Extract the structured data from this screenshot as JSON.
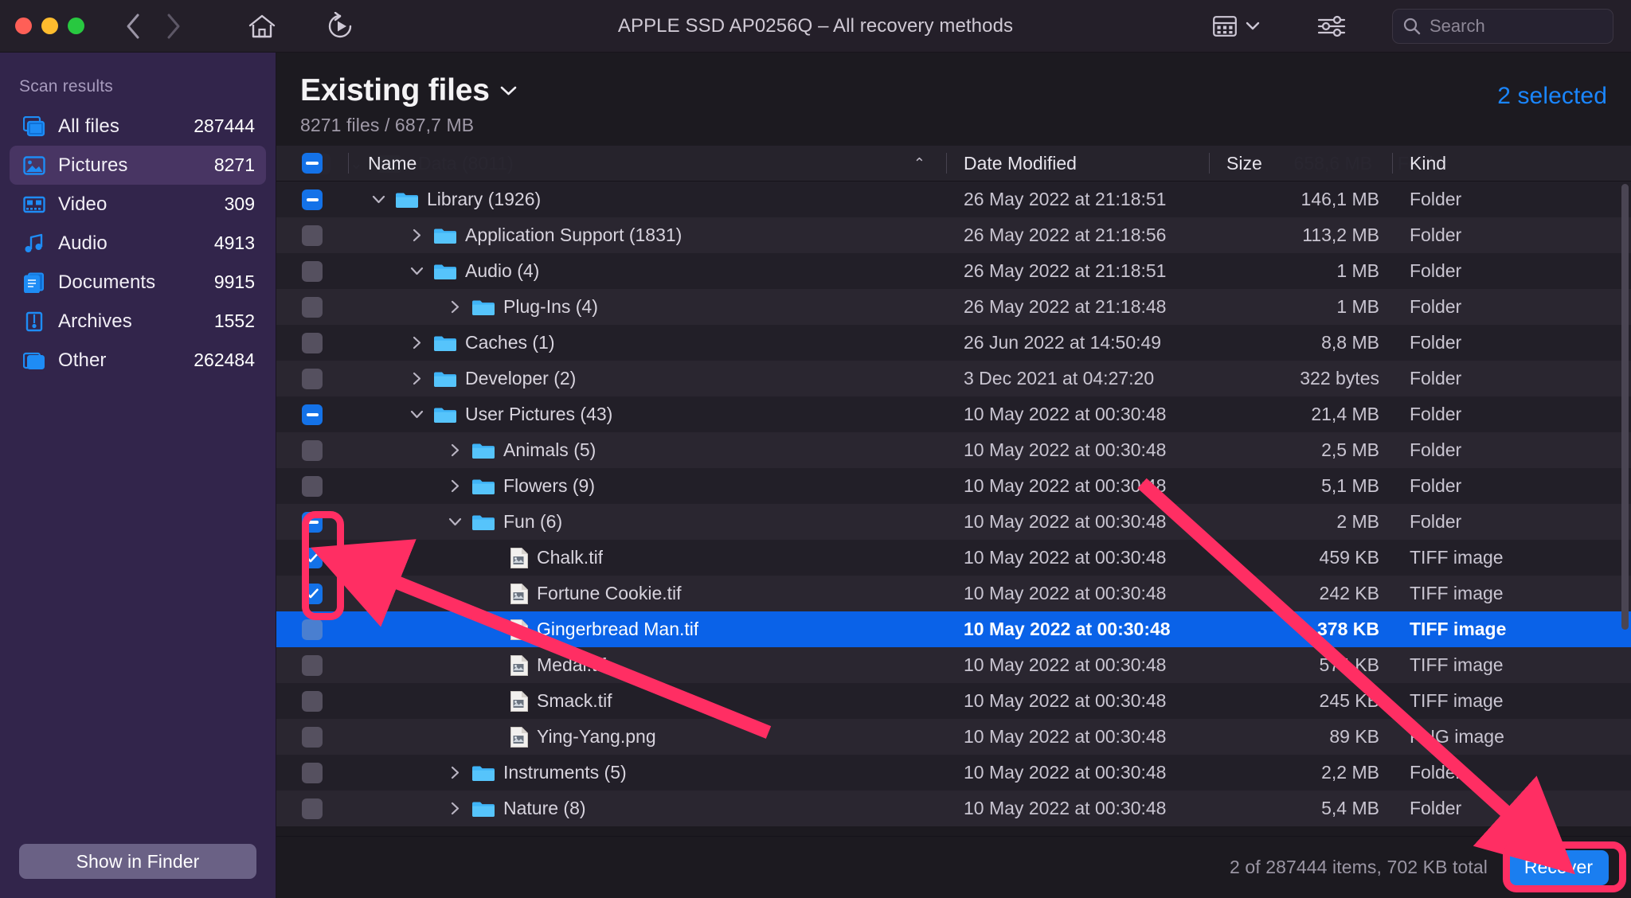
{
  "window": {
    "title": "APPLE SSD AP0256Q – All recovery methods",
    "traffic": [
      "close-button",
      "minimize-button",
      "maximize-button"
    ],
    "back_icon": "chevron-left-icon",
    "forward_icon": "chevron-right-icon",
    "home_icon": "home-icon",
    "rescan_icon": "replay-icon",
    "view_icon": "grid-view-icon",
    "view_chevron": "chevron-down-icon",
    "filter_icon": "sliders-icon",
    "search": {
      "placeholder": "Search",
      "value": "",
      "icon": "search-icon"
    }
  },
  "sidebar": {
    "header": "Scan results",
    "items": [
      {
        "label": "All files",
        "count": "287444",
        "icon": "all-files-icon",
        "active": false
      },
      {
        "label": "Pictures",
        "count": "8271",
        "icon": "pictures-icon",
        "active": true
      },
      {
        "label": "Video",
        "count": "309",
        "icon": "video-icon",
        "active": false
      },
      {
        "label": "Audio",
        "count": "4913",
        "icon": "audio-icon",
        "active": false
      },
      {
        "label": "Documents",
        "count": "9915",
        "icon": "documents-icon",
        "active": false
      },
      {
        "label": "Archives",
        "count": "1552",
        "icon": "archives-icon",
        "active": false
      },
      {
        "label": "Other",
        "count": "262484",
        "icon": "other-icon",
        "active": false
      }
    ],
    "show_in_finder": "Show in Finder"
  },
  "main": {
    "title": "Existing files",
    "title_chevron": "chevron-down-icon",
    "subtitle": "8271 files / 687,7 MB",
    "selected_label": "2 selected",
    "ghost_row": {
      "name": "Data (8011)",
      "size": "658,6 MB",
      "kind": "Folder"
    },
    "columns": {
      "name": "Name",
      "date": "Date Modified",
      "size": "Size",
      "kind": "Kind",
      "sort_icon": "chevron-up-icon",
      "header_checkbox": "mixed"
    },
    "rows": [
      {
        "name": "Library (1926)",
        "date": "26 May 2022 at 21:18:51",
        "size": "146,1 MB",
        "kind": "Folder",
        "indent": 0,
        "disclosure": "open",
        "check": "mixed",
        "type": "folder",
        "selected": false
      },
      {
        "name": "Application Support (1831)",
        "date": "26 May 2022 at 21:18:56",
        "size": "113,2 MB",
        "kind": "Folder",
        "indent": 1,
        "disclosure": "closed",
        "check": "off",
        "type": "folder",
        "selected": false
      },
      {
        "name": "Audio (4)",
        "date": "26 May 2022 at 21:18:51",
        "size": "1 MB",
        "kind": "Folder",
        "indent": 1,
        "disclosure": "open",
        "check": "off",
        "type": "folder",
        "selected": false
      },
      {
        "name": "Plug-Ins (4)",
        "date": "26 May 2022 at 21:18:48",
        "size": "1 MB",
        "kind": "Folder",
        "indent": 2,
        "disclosure": "closed",
        "check": "off",
        "type": "folder",
        "selected": false
      },
      {
        "name": "Caches (1)",
        "date": "26 Jun 2022 at 14:50:49",
        "size": "8,8 MB",
        "kind": "Folder",
        "indent": 1,
        "disclosure": "closed",
        "check": "off",
        "type": "folder",
        "selected": false
      },
      {
        "name": "Developer (2)",
        "date": "3 Dec 2021 at 04:27:20",
        "size": "322 bytes",
        "kind": "Folder",
        "indent": 1,
        "disclosure": "closed",
        "check": "off",
        "type": "folder",
        "selected": false
      },
      {
        "name": "User Pictures (43)",
        "date": "10 May 2022 at 00:30:48",
        "size": "21,4 MB",
        "kind": "Folder",
        "indent": 1,
        "disclosure": "open",
        "check": "mixed",
        "type": "folder",
        "selected": false
      },
      {
        "name": "Animals (5)",
        "date": "10 May 2022 at 00:30:48",
        "size": "2,5 MB",
        "kind": "Folder",
        "indent": 2,
        "disclosure": "closed",
        "check": "off",
        "type": "folder",
        "selected": false
      },
      {
        "name": "Flowers (9)",
        "date": "10 May 2022 at 00:30:48",
        "size": "5,1 MB",
        "kind": "Folder",
        "indent": 2,
        "disclosure": "closed",
        "check": "off",
        "type": "folder",
        "selected": false
      },
      {
        "name": "Fun (6)",
        "date": "10 May 2022 at 00:30:48",
        "size": "2 MB",
        "kind": "Folder",
        "indent": 2,
        "disclosure": "open",
        "check": "mixed",
        "type": "folder",
        "selected": false
      },
      {
        "name": "Chalk.tif",
        "date": "10 May 2022 at 00:30:48",
        "size": "459 KB",
        "kind": "TIFF image",
        "indent": 3,
        "disclosure": "none",
        "check": "on",
        "type": "file",
        "selected": false
      },
      {
        "name": "Fortune Cookie.tif",
        "date": "10 May 2022 at 00:30:48",
        "size": "242 KB",
        "kind": "TIFF image",
        "indent": 3,
        "disclosure": "none",
        "check": "on",
        "type": "file",
        "selected": false
      },
      {
        "name": "Gingerbread Man.tif",
        "date": "10 May 2022 at 00:30:48",
        "size": "378 KB",
        "kind": "TIFF image",
        "indent": 3,
        "disclosure": "none",
        "check": "dim",
        "type": "file",
        "selected": true
      },
      {
        "name": "Medal.tif",
        "date": "10 May 2022 at 00:30:48",
        "size": "574 KB",
        "kind": "TIFF image",
        "indent": 3,
        "disclosure": "none",
        "check": "off",
        "type": "file",
        "selected": false
      },
      {
        "name": "Smack.tif",
        "date": "10 May 2022 at 00:30:48",
        "size": "245 KB",
        "kind": "TIFF image",
        "indent": 3,
        "disclosure": "none",
        "check": "off",
        "type": "file",
        "selected": false
      },
      {
        "name": "Ying-Yang.png",
        "date": "10 May 2022 at 00:30:48",
        "size": "89 KB",
        "kind": "PNG image",
        "indent": 3,
        "disclosure": "none",
        "check": "off",
        "type": "file",
        "selected": false
      },
      {
        "name": "Instruments (5)",
        "date": "10 May 2022 at 00:30:48",
        "size": "2,2 MB",
        "kind": "Folder",
        "indent": 2,
        "disclosure": "closed",
        "check": "off",
        "type": "folder",
        "selected": false
      },
      {
        "name": "Nature (8)",
        "date": "10 May 2022 at 00:30:48",
        "size": "5,4 MB",
        "kind": "Folder",
        "indent": 2,
        "disclosure": "closed",
        "check": "off",
        "type": "folder",
        "selected": false
      }
    ]
  },
  "footer": {
    "status": "2 of 287444 items, 702 KB total",
    "recover_label": "Recover"
  },
  "annotations": {
    "highlight_color": "#ff2e63",
    "shapes": [
      "checkbox-highlight-box",
      "recover-highlight-box",
      "arrow-to-checkbox",
      "arrow-to-recover"
    ]
  },
  "colors": {
    "accent_blue": "#1a7ef0",
    "selection_blue": "#0a62e8",
    "sidebar_purple": "#32254b",
    "annotation_pink": "#ff2e63"
  }
}
